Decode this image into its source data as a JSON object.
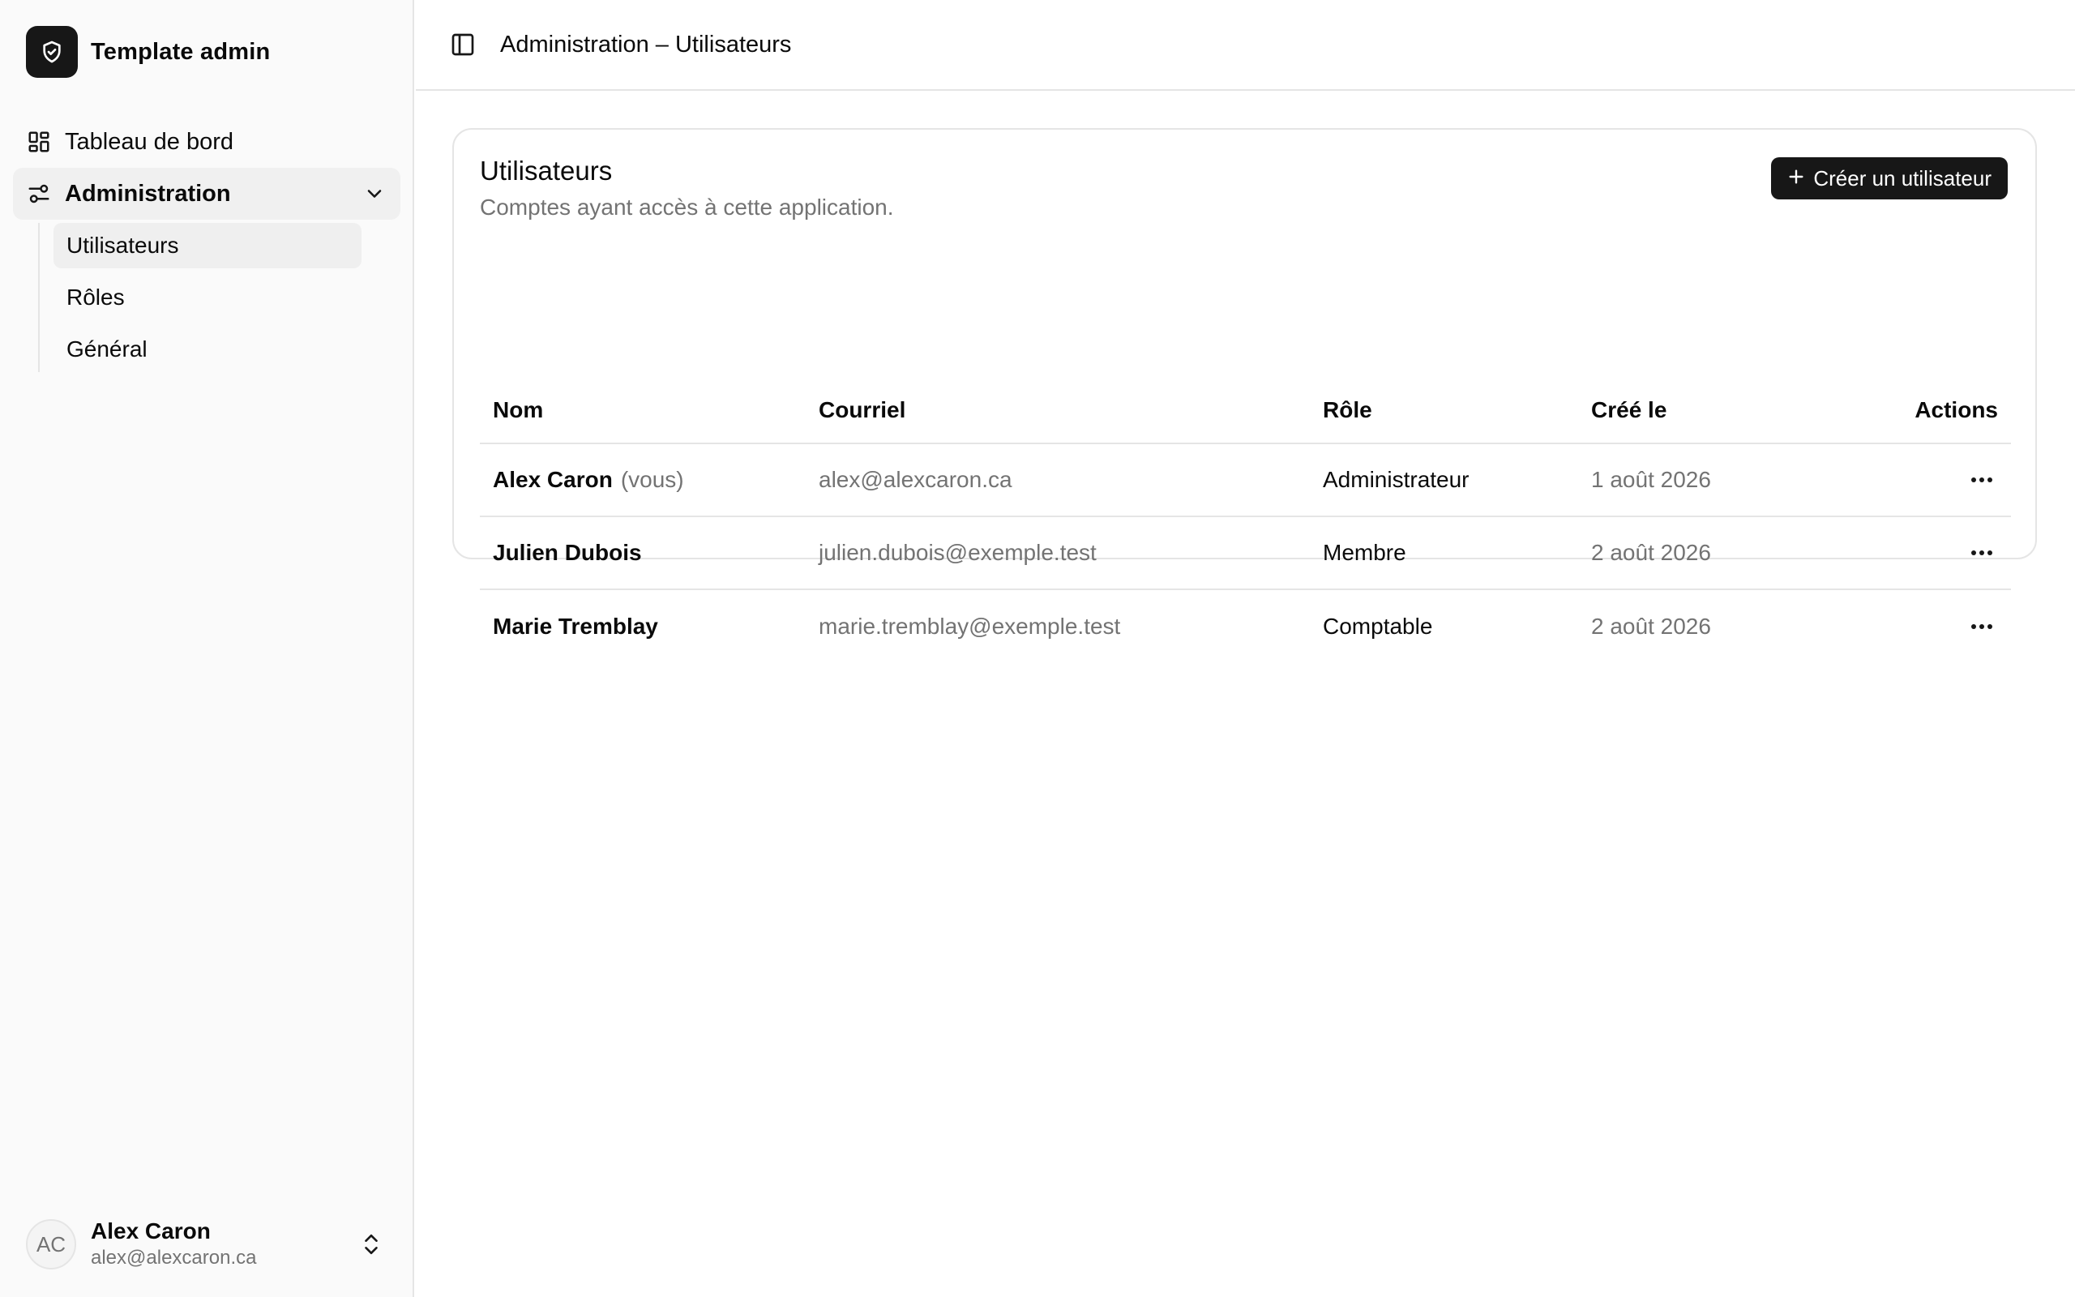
{
  "app": {
    "name": "Template admin"
  },
  "sidebar": {
    "items": [
      {
        "label": "Tableau de bord",
        "icon": "dashboard-icon"
      },
      {
        "label": "Administration",
        "icon": "settings-sliders-icon",
        "expanded": true
      }
    ],
    "subitems": [
      {
        "label": "Utilisateurs",
        "active": true
      },
      {
        "label": "Rôles",
        "active": false
      },
      {
        "label": "Général",
        "active": false
      }
    ]
  },
  "user": {
    "initials": "AC",
    "name": "Alex Caron",
    "email": "alex@alexcaron.ca"
  },
  "header": {
    "breadcrumb": "Administration – Utilisateurs"
  },
  "card": {
    "title": "Utilisateurs",
    "subtitle": "Comptes ayant accès à cette application.",
    "create_label": "Créer un utilisateur"
  },
  "table": {
    "columns": [
      "Nom",
      "Courriel",
      "Rôle",
      "Créé le",
      "Actions"
    ],
    "rows": [
      {
        "name": "Alex Caron",
        "you": "(vous)",
        "email": "alex@alexcaron.ca",
        "role": "Administrateur",
        "created": "1 août 2026"
      },
      {
        "name": "Julien Dubois",
        "you": "",
        "email": "julien.dubois@exemple.test",
        "role": "Membre",
        "created": "2 août 2026"
      },
      {
        "name": "Marie Tremblay",
        "you": "",
        "email": "marie.tremblay@exemple.test",
        "role": "Comptable",
        "created": "2 août 2026"
      }
    ]
  },
  "colors": {
    "accent": "#171717",
    "muted": "#737373",
    "border": "#e5e5e5",
    "sidebar_bg": "#fafafa"
  }
}
